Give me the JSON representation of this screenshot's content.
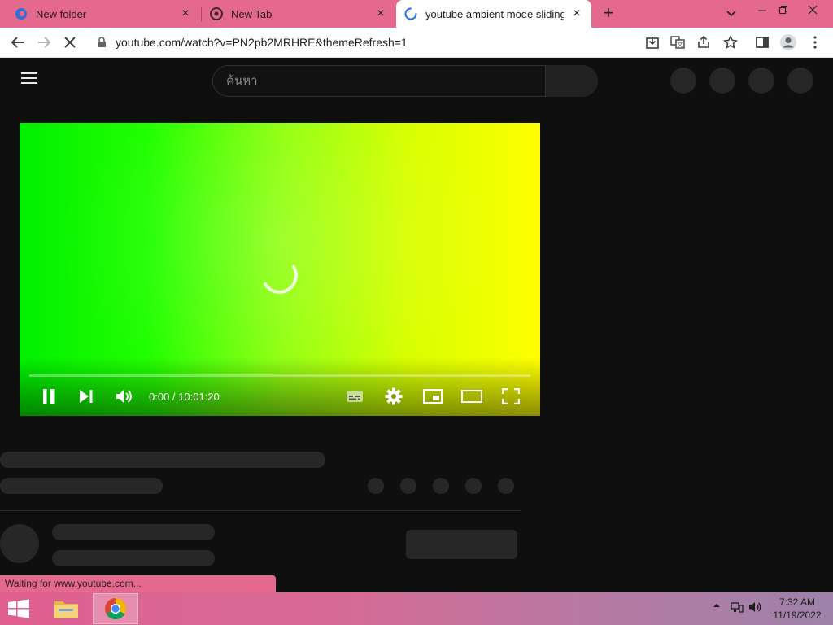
{
  "browser": {
    "tabs": [
      {
        "title": "New folder",
        "icon": "edge-like-icon",
        "active": false
      },
      {
        "title": "New Tab",
        "icon": "chrome-icon",
        "active": false
      },
      {
        "title": "youtube ambient mode sliding lo",
        "icon": "loading-spinner-icon",
        "active": true
      }
    ],
    "new_tab_symbol": "+",
    "tab_close_symbol": "×",
    "url": "youtube.com/watch?v=PN2pb2MRHRE&themeRefresh=1",
    "status_text": "Waiting for www.youtube.com...",
    "colors": {
      "frame": "#e5698f",
      "active_tab": "#ffffff"
    }
  },
  "youtube": {
    "search_placeholder": "ค้นหา",
    "player": {
      "time_label": "0:00 / 10:01:20",
      "loading": true
    },
    "colors": {
      "page_bg": "#0f0f0f",
      "skeleton": "#272727"
    }
  },
  "taskbar": {
    "time": "7:32 AM",
    "date": "11/19/2022",
    "apps": [
      "file-explorer-icon",
      "chrome-icon"
    ]
  }
}
